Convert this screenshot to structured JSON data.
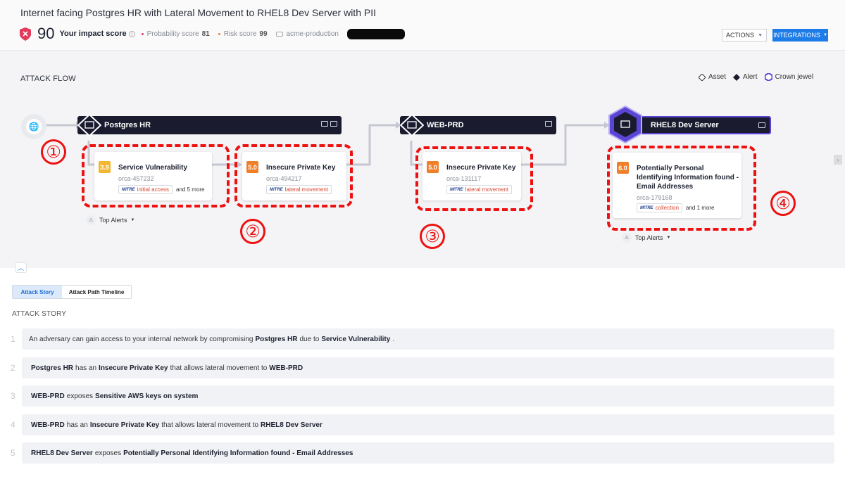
{
  "page_title": "Internet facing Postgres HR with Lateral Movement to RHEL8 Dev Server with PII",
  "score": {
    "impact_value": "90",
    "impact_label": "Your impact score",
    "probability_label": "Probability score",
    "probability_value": "81",
    "risk_label": "Risk score",
    "risk_value": "99",
    "account": "acme-production"
  },
  "actions": {
    "actions_label": "ACTIONS",
    "integrations_label": "INTEGRATIONS"
  },
  "flow": {
    "title": "ATTACK FLOW",
    "legend": {
      "asset": "Asset",
      "alert": "Alert",
      "crown": "Crown jewel"
    },
    "assets": [
      {
        "name": "Postgres HR"
      },
      {
        "name": "WEB-PRD"
      },
      {
        "name": "RHEL8 Dev Server"
      }
    ],
    "alerts": [
      {
        "score": "3.9",
        "title": "Service Vulnerability",
        "id": "orca-457232",
        "tactic": "initial access",
        "more": "and 5 more"
      },
      {
        "score": "5.0",
        "title": "Insecure Private Key",
        "id": "orca-494217",
        "tactic": "lateral movement",
        "more": ""
      },
      {
        "score": "5.0",
        "title": "Insecure Private Key",
        "id": "orca-131117",
        "tactic": "lateral movement",
        "more": ""
      },
      {
        "score": "6.0",
        "title": "Potentially Personal Identifying Information found - Email Addresses",
        "id": "orca-179168",
        "tactic": "collection",
        "more": "and 1 more"
      }
    ],
    "mitre_logo": "MITRE",
    "top_alerts_label": "Top Alerts",
    "annotations": [
      "①",
      "②",
      "③",
      "④"
    ]
  },
  "tabs": {
    "story": "Attack Story",
    "timeline": "Attack Path Timeline"
  },
  "story": {
    "title": "ATTACK STORY",
    "rows": [
      {
        "n": "1",
        "parts": [
          "An adversary can gain access to your internal network by compromising ",
          "Postgres HR",
          " due to ",
          "Service Vulnerability",
          "."
        ]
      },
      {
        "n": "2",
        "parts": [
          "",
          "Postgres HR",
          " has an ",
          "Insecure Private Key",
          " that allows lateral movement to ",
          "WEB-PRD",
          ""
        ]
      },
      {
        "n": "3",
        "parts": [
          "",
          "WEB-PRD",
          " exposes ",
          "Sensitive AWS keys on system",
          ""
        ]
      },
      {
        "n": "4",
        "parts": [
          "",
          "WEB-PRD",
          " has an ",
          "Insecure Private Key",
          " that allows lateral movement to ",
          "RHEL8 Dev Server",
          ""
        ]
      },
      {
        "n": "5",
        "parts": [
          "",
          "RHEL8 Dev Server",
          " exposes ",
          "Potentially Personal Identifying Information found - Email Addresses",
          ""
        ]
      }
    ]
  },
  "colors": {
    "accent_blue": "#1e7ce8",
    "severity_yellow": "#f2b632",
    "severity_orange": "#f07f2a",
    "asset_bar": "#1a1b2e",
    "crown_jewel": "#5b45d6",
    "annotation_red": "#ee1111"
  }
}
